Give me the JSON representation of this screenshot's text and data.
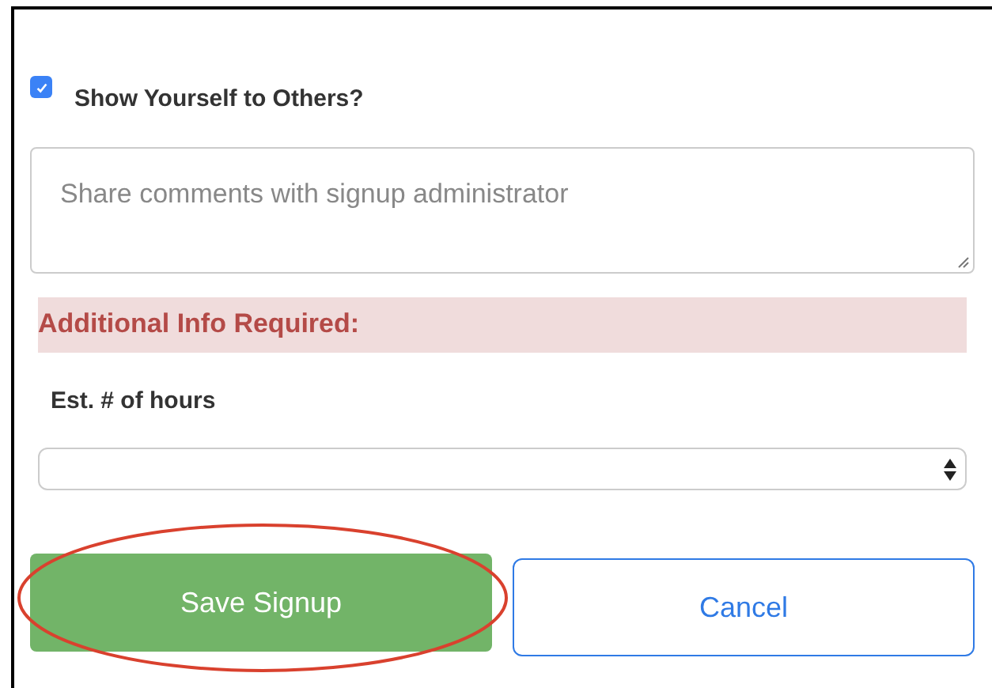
{
  "show_yourself": {
    "label": "Show Yourself to Others?",
    "checked": true
  },
  "comments": {
    "placeholder": "Share comments with signup administrator"
  },
  "alert": {
    "text": "Additional Info Required:"
  },
  "hours": {
    "label": "Est. # of hours"
  },
  "buttons": [
    {
      "label": "Save Signup",
      "kind": "primary",
      "highlighted": true
    },
    {
      "label": "Cancel",
      "kind": "secondary",
      "highlighted": false
    }
  ]
}
